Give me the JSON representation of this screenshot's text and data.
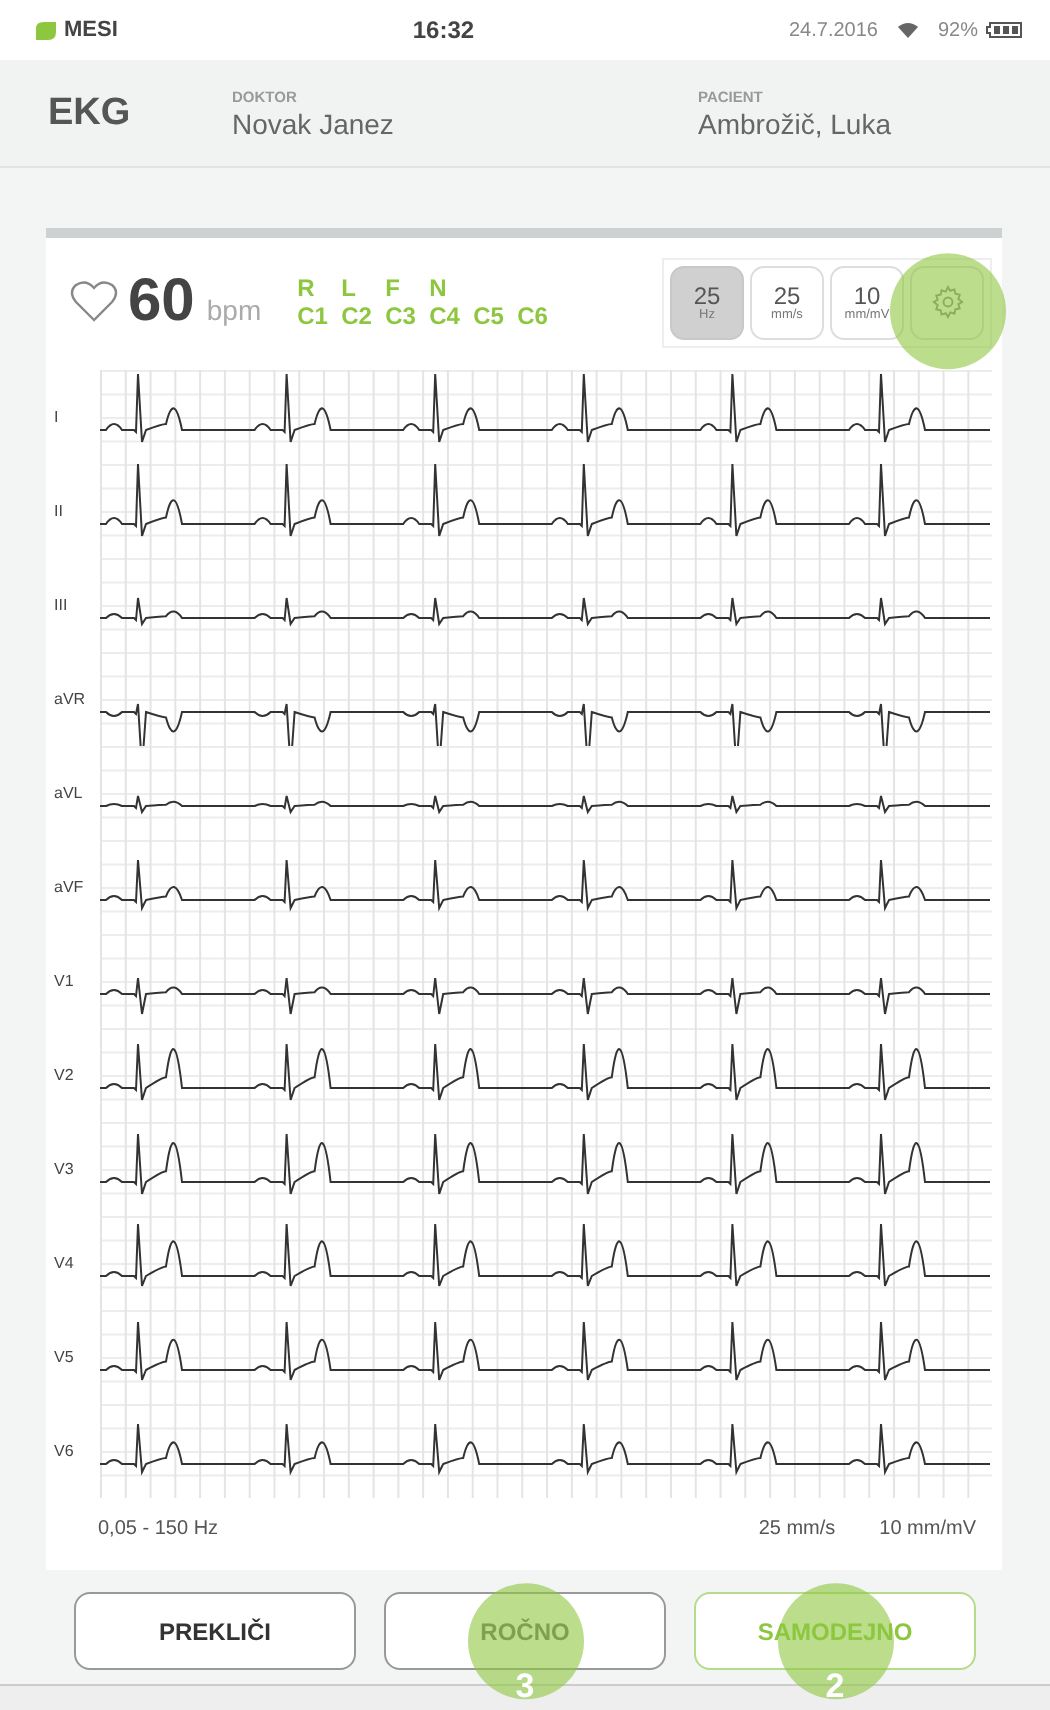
{
  "status_bar": {
    "brand": "MESI",
    "time": "16:32",
    "date": "24.7.2016",
    "battery": "92%"
  },
  "header": {
    "title": "EKG",
    "doctor_label": "DOKTOR",
    "doctor": "Novak Janez",
    "patient_label": "PACIENT",
    "patient": "Ambrožič, Luka"
  },
  "measurement": {
    "heart_rate": "60",
    "unit": "bpm",
    "electrodes": [
      [
        "R",
        "L",
        "F",
        "N"
      ],
      [
        "C1",
        "C2",
        "C3",
        "C4",
        "C5",
        "C6"
      ]
    ],
    "settings": [
      {
        "value": "25",
        "unit": "Hz",
        "selected": true,
        "touched": false
      },
      {
        "value": "25",
        "unit": "mm/s",
        "selected": false,
        "touched": false
      },
      {
        "value": "10",
        "unit": "mm/mV",
        "selected": false,
        "touched": false
      }
    ],
    "settings_button": {
      "touched": true
    }
  },
  "leads": [
    {
      "label": "I"
    },
    {
      "label": "II"
    },
    {
      "label": "III"
    },
    {
      "label": "aVR"
    },
    {
      "label": "aVL"
    },
    {
      "label": "aVF"
    },
    {
      "label": "V1"
    },
    {
      "label": "V2"
    },
    {
      "label": "V3"
    },
    {
      "label": "V4"
    },
    {
      "label": "V5"
    },
    {
      "label": "V6"
    }
  ],
  "footer": {
    "filter": "0,05 - 150 Hz",
    "speed": "25 mm/s",
    "gain": "10 mm/mV"
  },
  "buttons": [
    {
      "label": "PREKLIČI",
      "kind": "default",
      "touched": false
    },
    {
      "label": "ROČNO",
      "kind": "muted",
      "touched": true,
      "touch_label": "3"
    },
    {
      "label": "SAMODEJNO",
      "kind": "primary",
      "touched": true,
      "touch_label": "2"
    }
  ]
}
